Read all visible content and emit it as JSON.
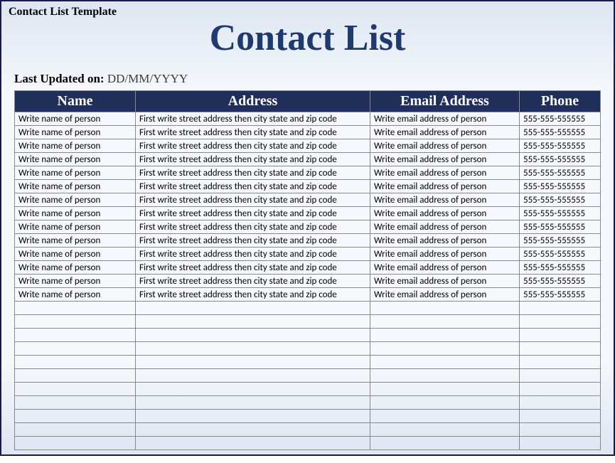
{
  "template_label": "Contact List Template",
  "main_title": "Contact List",
  "last_updated_label": "Last Updated on: ",
  "last_updated_value": "DD/MM/YYYY",
  "columns": {
    "name": "Name",
    "address": "Address",
    "email": "Email Address",
    "phone": "Phone"
  },
  "placeholder_row": {
    "name": "Write name of person",
    "address": "First write street address then city state and zip code",
    "email": "Write email address of person",
    "phone": "555-555-555555"
  },
  "filled_row_count": 14,
  "empty_row_count": 11
}
